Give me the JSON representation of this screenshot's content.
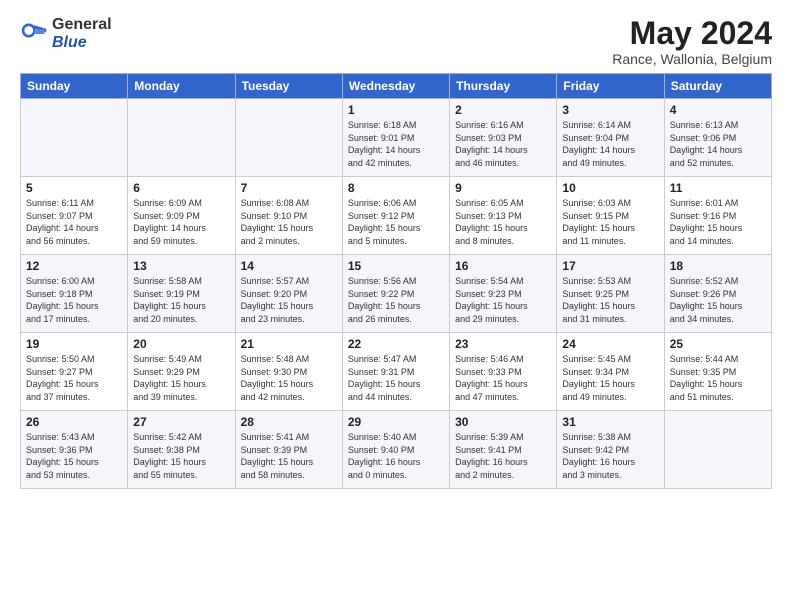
{
  "header": {
    "logo_general": "General",
    "logo_blue": "Blue",
    "month_title": "May 2024",
    "location": "Rance, Wallonia, Belgium"
  },
  "weekdays": [
    "Sunday",
    "Monday",
    "Tuesday",
    "Wednesday",
    "Thursday",
    "Friday",
    "Saturday"
  ],
  "weeks": [
    [
      {
        "day": "",
        "info": ""
      },
      {
        "day": "",
        "info": ""
      },
      {
        "day": "",
        "info": ""
      },
      {
        "day": "1",
        "info": "Sunrise: 6:18 AM\nSunset: 9:01 PM\nDaylight: 14 hours\nand 42 minutes."
      },
      {
        "day": "2",
        "info": "Sunrise: 6:16 AM\nSunset: 9:03 PM\nDaylight: 14 hours\nand 46 minutes."
      },
      {
        "day": "3",
        "info": "Sunrise: 6:14 AM\nSunset: 9:04 PM\nDaylight: 14 hours\nand 49 minutes."
      },
      {
        "day": "4",
        "info": "Sunrise: 6:13 AM\nSunset: 9:06 PM\nDaylight: 14 hours\nand 52 minutes."
      }
    ],
    [
      {
        "day": "5",
        "info": "Sunrise: 6:11 AM\nSunset: 9:07 PM\nDaylight: 14 hours\nand 56 minutes."
      },
      {
        "day": "6",
        "info": "Sunrise: 6:09 AM\nSunset: 9:09 PM\nDaylight: 14 hours\nand 59 minutes."
      },
      {
        "day": "7",
        "info": "Sunrise: 6:08 AM\nSunset: 9:10 PM\nDaylight: 15 hours\nand 2 minutes."
      },
      {
        "day": "8",
        "info": "Sunrise: 6:06 AM\nSunset: 9:12 PM\nDaylight: 15 hours\nand 5 minutes."
      },
      {
        "day": "9",
        "info": "Sunrise: 6:05 AM\nSunset: 9:13 PM\nDaylight: 15 hours\nand 8 minutes."
      },
      {
        "day": "10",
        "info": "Sunrise: 6:03 AM\nSunset: 9:15 PM\nDaylight: 15 hours\nand 11 minutes."
      },
      {
        "day": "11",
        "info": "Sunrise: 6:01 AM\nSunset: 9:16 PM\nDaylight: 15 hours\nand 14 minutes."
      }
    ],
    [
      {
        "day": "12",
        "info": "Sunrise: 6:00 AM\nSunset: 9:18 PM\nDaylight: 15 hours\nand 17 minutes."
      },
      {
        "day": "13",
        "info": "Sunrise: 5:58 AM\nSunset: 9:19 PM\nDaylight: 15 hours\nand 20 minutes."
      },
      {
        "day": "14",
        "info": "Sunrise: 5:57 AM\nSunset: 9:20 PM\nDaylight: 15 hours\nand 23 minutes."
      },
      {
        "day": "15",
        "info": "Sunrise: 5:56 AM\nSunset: 9:22 PM\nDaylight: 15 hours\nand 26 minutes."
      },
      {
        "day": "16",
        "info": "Sunrise: 5:54 AM\nSunset: 9:23 PM\nDaylight: 15 hours\nand 29 minutes."
      },
      {
        "day": "17",
        "info": "Sunrise: 5:53 AM\nSunset: 9:25 PM\nDaylight: 15 hours\nand 31 minutes."
      },
      {
        "day": "18",
        "info": "Sunrise: 5:52 AM\nSunset: 9:26 PM\nDaylight: 15 hours\nand 34 minutes."
      }
    ],
    [
      {
        "day": "19",
        "info": "Sunrise: 5:50 AM\nSunset: 9:27 PM\nDaylight: 15 hours\nand 37 minutes."
      },
      {
        "day": "20",
        "info": "Sunrise: 5:49 AM\nSunset: 9:29 PM\nDaylight: 15 hours\nand 39 minutes."
      },
      {
        "day": "21",
        "info": "Sunrise: 5:48 AM\nSunset: 9:30 PM\nDaylight: 15 hours\nand 42 minutes."
      },
      {
        "day": "22",
        "info": "Sunrise: 5:47 AM\nSunset: 9:31 PM\nDaylight: 15 hours\nand 44 minutes."
      },
      {
        "day": "23",
        "info": "Sunrise: 5:46 AM\nSunset: 9:33 PM\nDaylight: 15 hours\nand 47 minutes."
      },
      {
        "day": "24",
        "info": "Sunrise: 5:45 AM\nSunset: 9:34 PM\nDaylight: 15 hours\nand 49 minutes."
      },
      {
        "day": "25",
        "info": "Sunrise: 5:44 AM\nSunset: 9:35 PM\nDaylight: 15 hours\nand 51 minutes."
      }
    ],
    [
      {
        "day": "26",
        "info": "Sunrise: 5:43 AM\nSunset: 9:36 PM\nDaylight: 15 hours\nand 53 minutes."
      },
      {
        "day": "27",
        "info": "Sunrise: 5:42 AM\nSunset: 9:38 PM\nDaylight: 15 hours\nand 55 minutes."
      },
      {
        "day": "28",
        "info": "Sunrise: 5:41 AM\nSunset: 9:39 PM\nDaylight: 15 hours\nand 58 minutes."
      },
      {
        "day": "29",
        "info": "Sunrise: 5:40 AM\nSunset: 9:40 PM\nDaylight: 16 hours\nand 0 minutes."
      },
      {
        "day": "30",
        "info": "Sunrise: 5:39 AM\nSunset: 9:41 PM\nDaylight: 16 hours\nand 2 minutes."
      },
      {
        "day": "31",
        "info": "Sunrise: 5:38 AM\nSunset: 9:42 PM\nDaylight: 16 hours\nand 3 minutes."
      },
      {
        "day": "",
        "info": ""
      }
    ]
  ]
}
